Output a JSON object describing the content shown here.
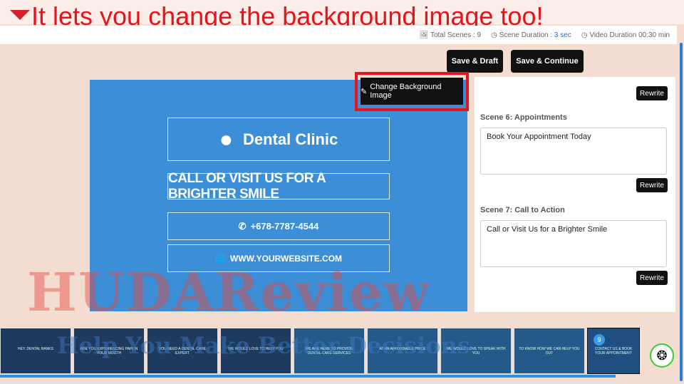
{
  "caption": "It lets you change the background image too!",
  "stats": {
    "total_scenes": "Total Scenes : 9",
    "scene_duration_label": "Scene Duration : ",
    "scene_duration_value": "3 sec",
    "video_duration": "Video Duration 00:30 min"
  },
  "buttons": {
    "save_draft": "Save & Draft",
    "save_continue": "Save & Continue",
    "change_bg": "Change Background Image",
    "rewrite": "Rewrite"
  },
  "canvas": {
    "logo_text": "Dental Clinic",
    "headline": "CALL OR VISIT US FOR A BRIGHTER SMILE",
    "phone": "+678-7787-4544",
    "website": "WWW.YOURWEBSITE.COM"
  },
  "scenes": [
    {
      "label": "Scene 6: Appointments",
      "text": "Book Your Appointment Today"
    },
    {
      "label": "Scene 7: Call to Action",
      "text": "Call or Visit Us for a Brighter Smile"
    }
  ],
  "thumbnails": [
    "HEY, DENTAL BANKS",
    "ARE YOU EXPERIENCING PAIN IN YOUR MOUTH",
    "YOU NEED A DENTAL CARE EXPERT",
    "WE WOULD LOVE TO HELP YOU",
    "WE ARE HERE TO PROVIDE DENTAL CARE SERVICES",
    "AT AN AFFORDABLE PRICE",
    "WE WOULD LOVE TO SPEAK WITH YOU",
    "TO KNOW HOW WE CAN HELP YOU OUT",
    "CONTACT US & BOOK YOUR APPOINTMENT"
  ],
  "active_thumb_badge": "9",
  "watermark": {
    "main": "HUDAReview",
    "sub": "Help You Make Better Decisions"
  }
}
